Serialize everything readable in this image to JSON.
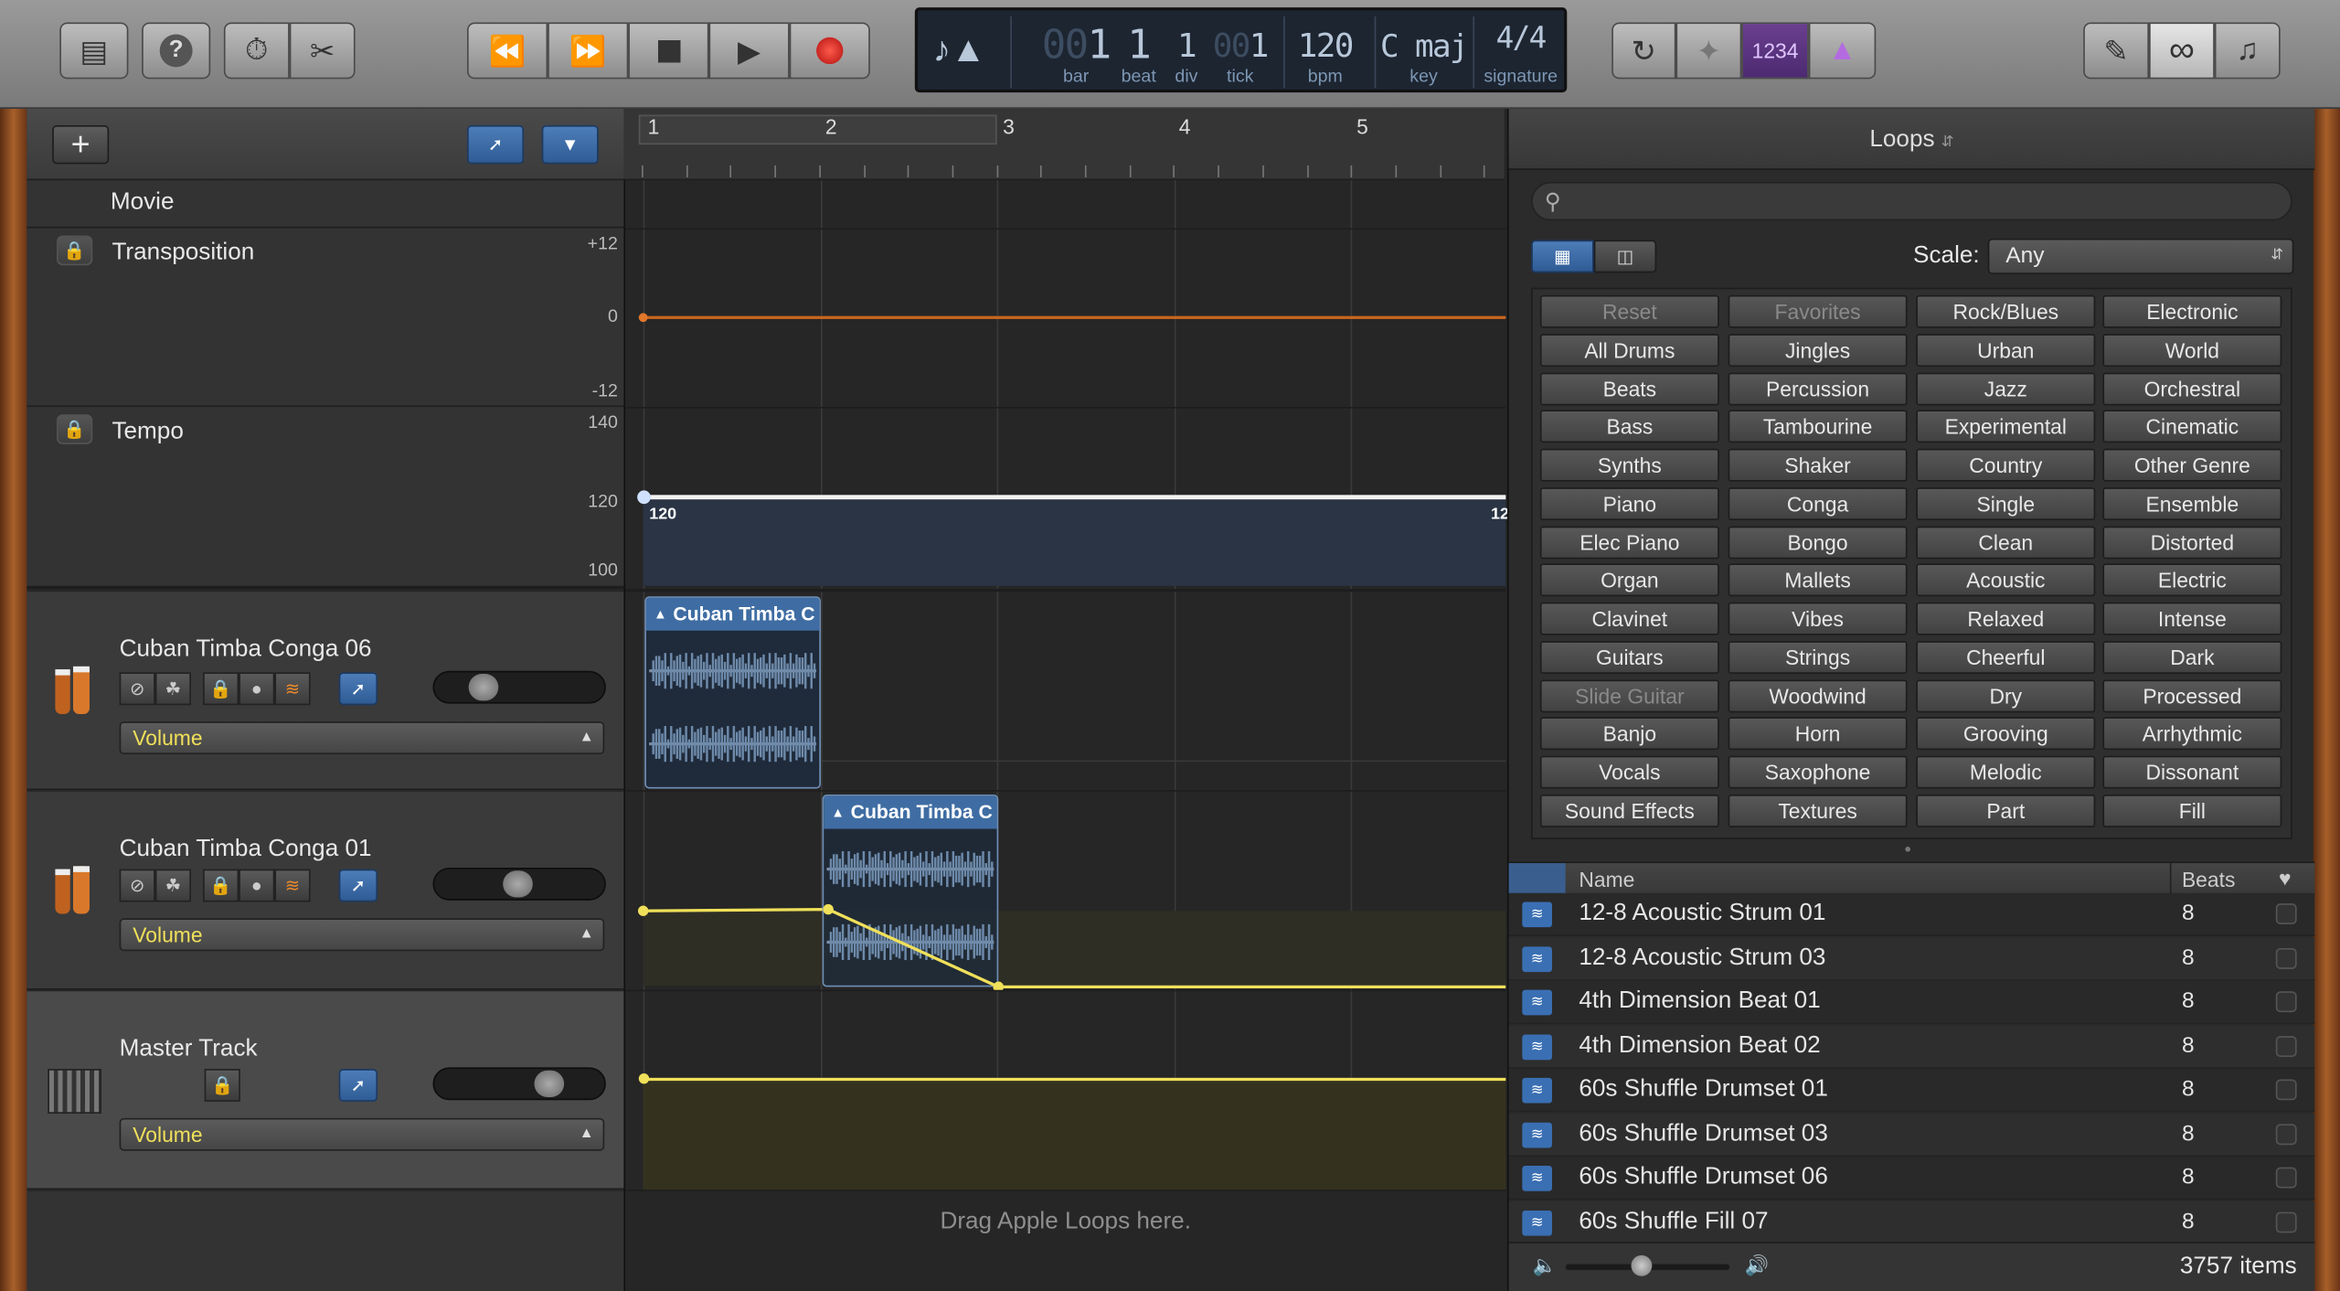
{
  "toolbar": {
    "lcd": {
      "bar": "1",
      "bar_ghost": "00",
      "bar_label": "bar",
      "beat": "1",
      "beat_label": "beat",
      "div": "1",
      "div_label": "div",
      "tick": "1",
      "tick_ghost": "00",
      "tick_label": "tick",
      "bpm": "120",
      "bpm_label": "bpm",
      "key": "C maj",
      "key_label": "key",
      "signature": "4/4",
      "signature_label": "signature"
    },
    "count_in": "1234"
  },
  "movie": {
    "label": "Movie"
  },
  "transposition": {
    "label": "Transposition",
    "scale_top": "+12",
    "scale_mid": "0",
    "scale_bot": "-12"
  },
  "tempo": {
    "label": "Tempo",
    "scale_top": "140",
    "scale_mid": "120",
    "scale_bot": "100",
    "start_value": "120",
    "end_value": "12"
  },
  "ruler": [
    "1",
    "2",
    "3",
    "4",
    "5"
  ],
  "tracks": [
    {
      "name": "Cuban Timba Conga 06",
      "automation": "Volume",
      "region": "Cuban Timba C",
      "volume": 0.22
    },
    {
      "name": "Cuban Timba Conga 01",
      "automation": "Volume",
      "region": "Cuban Timba C",
      "volume": 0.48
    },
    {
      "name": "Master Track",
      "automation": "Volume",
      "volume": 0.72
    }
  ],
  "drag_hint": "Drag Apple Loops here.",
  "loops": {
    "title": "Loops",
    "search_placeholder": "",
    "scale_label": "Scale:",
    "scale_value": "Any",
    "keywords": [
      [
        "Reset",
        "Favorites",
        "Rock/Blues",
        "Electronic"
      ],
      [
        "All Drums",
        "Jingles",
        "Urban",
        "World"
      ],
      [
        "Beats",
        "Percussion",
        "Jazz",
        "Orchestral"
      ],
      [
        "Bass",
        "Tambourine",
        "Experimental",
        "Cinematic"
      ],
      [
        "Synths",
        "Shaker",
        "Country",
        "Other Genre"
      ],
      [
        "Piano",
        "Conga",
        "Single",
        "Ensemble"
      ],
      [
        "Elec Piano",
        "Bongo",
        "Clean",
        "Distorted"
      ],
      [
        "Organ",
        "Mallets",
        "Acoustic",
        "Electric"
      ],
      [
        "Clavinet",
        "Vibes",
        "Relaxed",
        "Intense"
      ],
      [
        "Guitars",
        "Strings",
        "Cheerful",
        "Dark"
      ],
      [
        "Slide Guitar",
        "Woodwind",
        "Dry",
        "Processed"
      ],
      [
        "Banjo",
        "Horn",
        "Grooving",
        "Arrhythmic"
      ],
      [
        "Vocals",
        "Saxophone",
        "Melodic",
        "Dissonant"
      ],
      [
        "Sound Effects",
        "Textures",
        "Part",
        "Fill"
      ]
    ],
    "col_name": "Name",
    "col_beats": "Beats",
    "items": [
      {
        "name": "12-8 Acoustic Strum 01",
        "beats": "8"
      },
      {
        "name": "12-8 Acoustic Strum 03",
        "beats": "8"
      },
      {
        "name": "4th Dimension Beat 01",
        "beats": "8"
      },
      {
        "name": "4th Dimension Beat 02",
        "beats": "8"
      },
      {
        "name": "60s Shuffle Drumset 01",
        "beats": "8"
      },
      {
        "name": "60s Shuffle Drumset 03",
        "beats": "8"
      },
      {
        "name": "60s Shuffle Drumset 06",
        "beats": "8"
      },
      {
        "name": "60s Shuffle Fill 07",
        "beats": "8"
      }
    ],
    "count": "3757 items"
  }
}
